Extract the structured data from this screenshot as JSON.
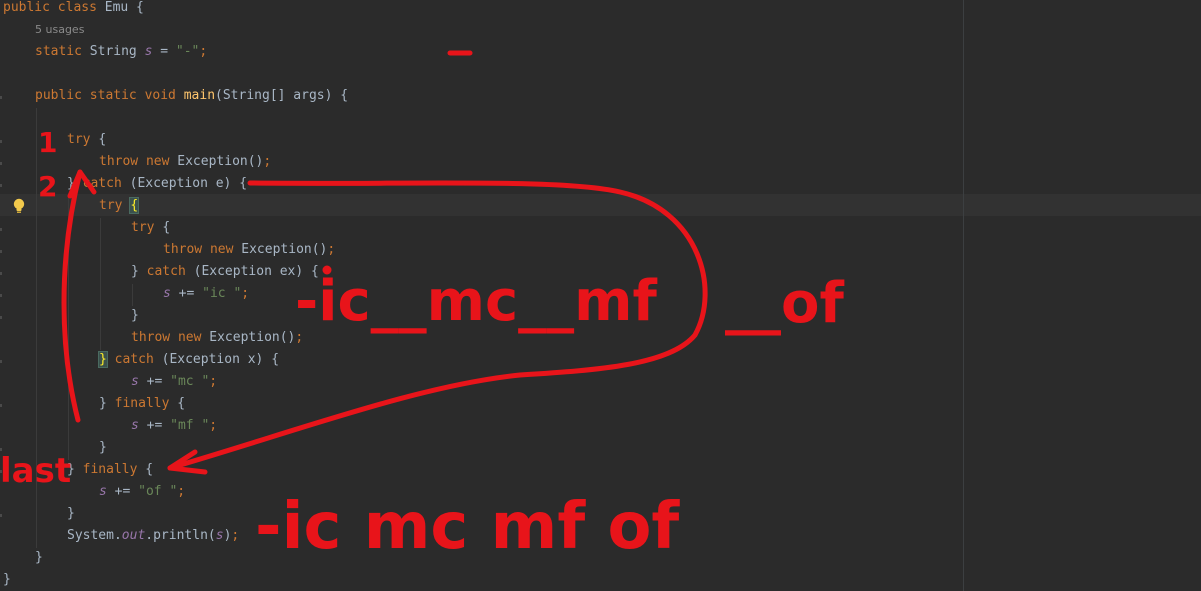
{
  "editor": {
    "hint_usages": "5 usages",
    "lines": [
      {
        "id": "l1",
        "tokens": [
          {
            "t": "public class ",
            "c": "kw"
          },
          {
            "t": "Emu {",
            "c": "p"
          }
        ]
      },
      {
        "id": "l3",
        "tokens": [
          {
            "t": "static ",
            "c": "kw"
          },
          {
            "t": "String ",
            "c": "p"
          },
          {
            "t": "s",
            "c": "fld"
          },
          {
            "t": " = ",
            "c": "p"
          },
          {
            "t": "\"-\"",
            "c": "str"
          },
          {
            "t": ";",
            "c": "kw"
          }
        ]
      },
      {
        "id": "l5",
        "tokens": [
          {
            "t": "public static void ",
            "c": "kw"
          },
          {
            "t": "main",
            "c": "fn"
          },
          {
            "t": "(String[] args) {",
            "c": "p"
          }
        ]
      },
      {
        "id": "l7",
        "tokens": [
          {
            "t": "try ",
            "c": "kw"
          },
          {
            "t": "{",
            "c": "p"
          }
        ]
      },
      {
        "id": "l8",
        "tokens": [
          {
            "t": "throw new ",
            "c": "kw"
          },
          {
            "t": "Exception()",
            "c": "p"
          },
          {
            "t": ";",
            "c": "kw"
          }
        ]
      },
      {
        "id": "l9",
        "tokens": [
          {
            "t": "} ",
            "c": "p"
          },
          {
            "t": "catch ",
            "c": "kw"
          },
          {
            "t": "(Exception e) {",
            "c": "p"
          }
        ]
      },
      {
        "id": "l10",
        "tokens": [
          {
            "t": "try ",
            "c": "kw"
          },
          {
            "t": "{",
            "c": "hl"
          }
        ]
      },
      {
        "id": "l11",
        "tokens": [
          {
            "t": "try ",
            "c": "kw"
          },
          {
            "t": "{",
            "c": "p"
          }
        ]
      },
      {
        "id": "l12",
        "tokens": [
          {
            "t": "throw new ",
            "c": "kw"
          },
          {
            "t": "Exception()",
            "c": "p"
          },
          {
            "t": ";",
            "c": "kw"
          }
        ]
      },
      {
        "id": "l13",
        "tokens": [
          {
            "t": "} ",
            "c": "p"
          },
          {
            "t": "catch ",
            "c": "kw"
          },
          {
            "t": "(Exception ex) {",
            "c": "p"
          }
        ]
      },
      {
        "id": "l14",
        "tokens": [
          {
            "t": "s",
            "c": "fld"
          },
          {
            "t": " += ",
            "c": "p"
          },
          {
            "t": "\"ic \"",
            "c": "str"
          },
          {
            "t": ";",
            "c": "kw"
          }
        ]
      },
      {
        "id": "l15",
        "tokens": [
          {
            "t": "}",
            "c": "p"
          }
        ]
      },
      {
        "id": "l16",
        "tokens": [
          {
            "t": "throw new ",
            "c": "kw"
          },
          {
            "t": "Exception()",
            "c": "p"
          },
          {
            "t": ";",
            "c": "kw"
          }
        ]
      },
      {
        "id": "l17",
        "tokens": [
          {
            "t": "}",
            "c": "hl"
          },
          {
            "t": " ",
            "c": "p"
          },
          {
            "t": "catch ",
            "c": "kw"
          },
          {
            "t": "(Exception x) {",
            "c": "p"
          }
        ]
      },
      {
        "id": "l18",
        "tokens": [
          {
            "t": "s",
            "c": "fld"
          },
          {
            "t": " += ",
            "c": "p"
          },
          {
            "t": "\"mc \"",
            "c": "str"
          },
          {
            "t": ";",
            "c": "kw"
          }
        ]
      },
      {
        "id": "l19",
        "tokens": [
          {
            "t": "} ",
            "c": "p"
          },
          {
            "t": "finally ",
            "c": "kw"
          },
          {
            "t": "{",
            "c": "p"
          }
        ]
      },
      {
        "id": "l20",
        "tokens": [
          {
            "t": "s",
            "c": "fld"
          },
          {
            "t": " += ",
            "c": "p"
          },
          {
            "t": "\"mf \"",
            "c": "str"
          },
          {
            "t": ";",
            "c": "kw"
          }
        ]
      },
      {
        "id": "l21",
        "tokens": [
          {
            "t": "}",
            "c": "p"
          }
        ]
      },
      {
        "id": "l22",
        "tokens": [
          {
            "t": "} ",
            "c": "p"
          },
          {
            "t": "finally ",
            "c": "kw"
          },
          {
            "t": "{",
            "c": "p"
          }
        ]
      },
      {
        "id": "l23",
        "tokens": [
          {
            "t": "s",
            "c": "fld"
          },
          {
            "t": " += ",
            "c": "p"
          },
          {
            "t": "\"of \"",
            "c": "str"
          },
          {
            "t": ";",
            "c": "kw"
          }
        ]
      },
      {
        "id": "l24",
        "tokens": [
          {
            "t": "}",
            "c": "p"
          }
        ]
      },
      {
        "id": "l25",
        "tokens": [
          {
            "t": "System.",
            "c": "p"
          },
          {
            "t": "out",
            "c": "fld"
          },
          {
            "t": ".println(",
            "c": "p"
          },
          {
            "t": "s",
            "c": "fld"
          },
          {
            "t": ")",
            "c": "p"
          },
          {
            "t": ";",
            "c": "kw"
          }
        ]
      },
      {
        "id": "l26",
        "tokens": [
          {
            "t": "}",
            "c": "p"
          }
        ]
      },
      {
        "id": "l27",
        "tokens": [
          {
            "t": "}",
            "c": "p"
          }
        ]
      }
    ]
  },
  "annotations": {
    "num_1": "1",
    "num_2": "2",
    "last_label": "last",
    "mid_note": "-ic__mc__mf",
    "side_note": "__of",
    "result_note": "-ic mc mf of"
  }
}
